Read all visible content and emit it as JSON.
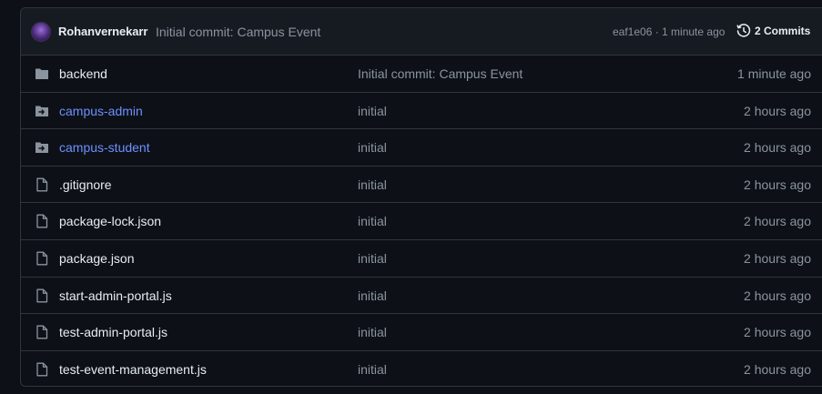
{
  "commit": {
    "author": "Rohanvernekarr",
    "message": "Initial commit: Campus Event",
    "meta": "eaf1e06 · 1 minute ago",
    "commits_label": "2 Commits"
  },
  "colors": {
    "background": "#0d1117",
    "header_bg": "#161b22",
    "border": "#30363d",
    "link": "#6e8fff",
    "muted": "#8b949e"
  },
  "files": [
    {
      "name": "backend",
      "type": "folder",
      "icon": "folder-icon",
      "message": "Initial commit: Campus Event",
      "time": "1 minute ago"
    },
    {
      "name": "campus-admin",
      "type": "submodule",
      "icon": "submodule-folder-icon",
      "message": "initial",
      "time": "2 hours ago"
    },
    {
      "name": "campus-student",
      "type": "submodule",
      "icon": "submodule-folder-icon",
      "message": "initial",
      "time": "2 hours ago"
    },
    {
      "name": ".gitignore",
      "type": "file",
      "icon": "file-icon",
      "message": "initial",
      "time": "2 hours ago"
    },
    {
      "name": "package-lock.json",
      "type": "file",
      "icon": "file-icon",
      "message": "initial",
      "time": "2 hours ago"
    },
    {
      "name": "package.json",
      "type": "file",
      "icon": "file-icon",
      "message": "initial",
      "time": "2 hours ago"
    },
    {
      "name": "start-admin-portal.js",
      "type": "file",
      "icon": "file-icon",
      "message": "initial",
      "time": "2 hours ago"
    },
    {
      "name": "test-admin-portal.js",
      "type": "file",
      "icon": "file-icon",
      "message": "initial",
      "time": "2 hours ago"
    },
    {
      "name": "test-event-management.js",
      "type": "file",
      "icon": "file-icon",
      "message": "initial",
      "time": "2 hours ago"
    }
  ]
}
